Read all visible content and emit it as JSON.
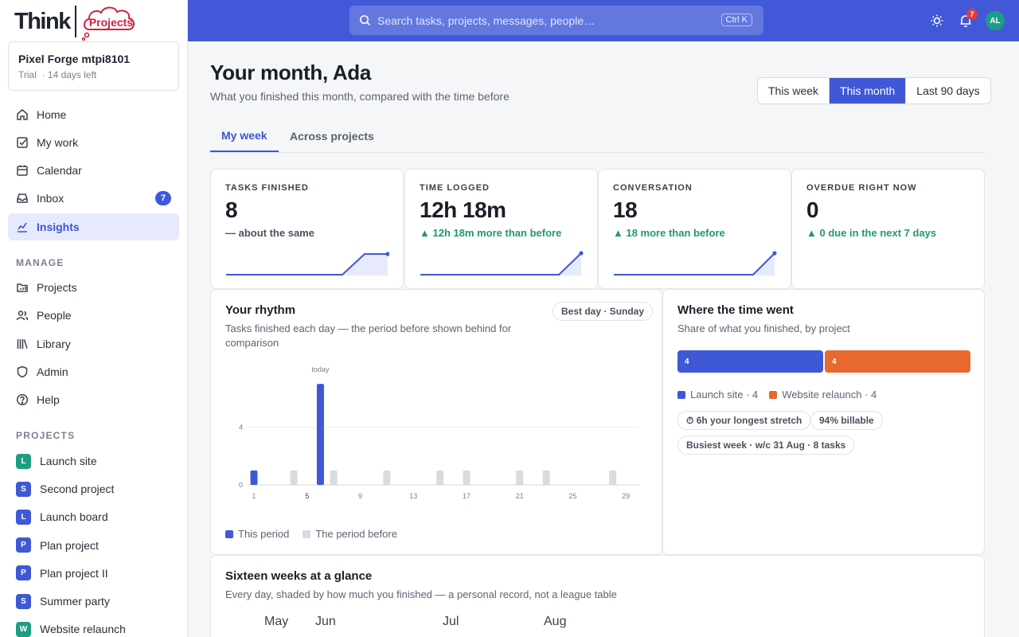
{
  "brand": {
    "think": "Think",
    "projects": "Projects"
  },
  "org": {
    "name": "Pixel Forge mtpi8101",
    "plan": "Trial",
    "days_left": "· 14 days left"
  },
  "nav": {
    "home": "Home",
    "my_work": "My work",
    "calendar": "Calendar",
    "inbox": "Inbox",
    "inbox_count": "7",
    "insights": "Insights"
  },
  "manage": {
    "label": "MANAGE",
    "projects": "Projects",
    "people": "People",
    "library": "Library",
    "admin": "Admin",
    "help": "Help"
  },
  "projects": {
    "label": "PROJECTS",
    "items": [
      {
        "initial": "L",
        "name": "Launch site",
        "color": "#1d9e84"
      },
      {
        "initial": "S",
        "name": "Second project",
        "color": "#3e58d6"
      },
      {
        "initial": "L",
        "name": "Launch board",
        "color": "#3e58d6"
      },
      {
        "initial": "P",
        "name": "Plan project",
        "color": "#3e58d6"
      },
      {
        "initial": "P",
        "name": "Plan project II",
        "color": "#3e58d6"
      },
      {
        "initial": "S",
        "name": "Summer party",
        "color": "#3e58d6"
      },
      {
        "initial": "W",
        "name": "Website relaunch",
        "color": "#1d9e84"
      }
    ]
  },
  "topbar": {
    "search_placeholder": "Search tasks, projects, messages, people…",
    "shortcut": "Ctrl K",
    "notifications": "7",
    "avatar": "AL"
  },
  "header": {
    "title": "Your month, Ada",
    "subtitle": "What you finished this month, compared with the time before",
    "ranges": [
      "This week",
      "This month",
      "Last 90 days"
    ],
    "selected_range": "This month"
  },
  "tabs": [
    "My week",
    "Across projects"
  ],
  "stats": [
    {
      "label": "TASKS FINISHED",
      "value": "8",
      "delta": "— about the same"
    },
    {
      "label": "TIME LOGGED",
      "value": "12h 18m",
      "delta": "▲ 12h 18m more than before"
    },
    {
      "label": "CONVERSATION",
      "value": "18",
      "delta": "▲ 18 more than before"
    },
    {
      "label": "OVERDUE RIGHT NOW",
      "value": "0",
      "delta": "▲ 0 due in the next 7 days"
    }
  ],
  "rhythm": {
    "title": "Your rhythm",
    "subtitle": "Tasks finished each day — the period before shown behind for comparison",
    "chip": "Best day · Sunday",
    "today": "today",
    "legend_this": "This period",
    "legend_before": "The period before"
  },
  "timewent": {
    "title": "Where the time went",
    "subtitle": "Share of what you finished, by project",
    "legend_a": "Launch site · 4",
    "legend_b": "Website relaunch · 4",
    "chip_a": "⏱ 6h your longest stretch",
    "chip_b": "94% billable",
    "chip_c": "Busiest week · w/c 31 Aug · 8 tasks"
  },
  "sixteen": {
    "title": "Sixteen weeks at a glance",
    "subtitle": "Every day, shaded by how much you finished — a personal record, not a league table",
    "months": [
      "May",
      "Jun",
      "Jul",
      "Aug"
    ]
  },
  "colors": {
    "accent": "#3e58d6",
    "orange": "#e8692f",
    "green": "#1e9a6c",
    "before": "#d9dbe2"
  },
  "chart_data": [
    {
      "type": "bar",
      "title": "Your rhythm",
      "x": [
        1,
        2,
        3,
        4,
        5,
        6,
        7,
        8,
        9,
        10,
        11,
        12,
        13,
        14,
        15,
        16,
        17,
        18,
        19,
        20,
        21,
        22,
        23,
        24,
        25,
        26,
        27,
        28,
        29,
        30
      ],
      "xticks": [
        1,
        5,
        9,
        13,
        17,
        21,
        25,
        29
      ],
      "yticks": [
        0,
        4
      ],
      "ylim": [
        0,
        8
      ],
      "series": [
        {
          "name": "This period",
          "color": "#3e58d6",
          "values": [
            1,
            0,
            0,
            0,
            0,
            7,
            0,
            0,
            0,
            0,
            0,
            0,
            0,
            0,
            0,
            0,
            0,
            0,
            0,
            0,
            0,
            0,
            0,
            0,
            0,
            0,
            0,
            0,
            0,
            0
          ]
        },
        {
          "name": "The period before",
          "color": "#d9dbe2",
          "values": [
            0,
            0,
            0,
            1,
            0,
            0,
            1,
            0,
            0,
            0,
            1,
            0,
            0,
            0,
            1,
            0,
            1,
            0,
            0,
            0,
            1,
            0,
            1,
            0,
            0,
            0,
            0,
            1,
            0,
            0
          ]
        }
      ]
    },
    {
      "type": "bar",
      "title": "Where the time went",
      "categories": [
        "Launch site",
        "Website relaunch"
      ],
      "values": [
        4,
        4
      ]
    }
  ]
}
